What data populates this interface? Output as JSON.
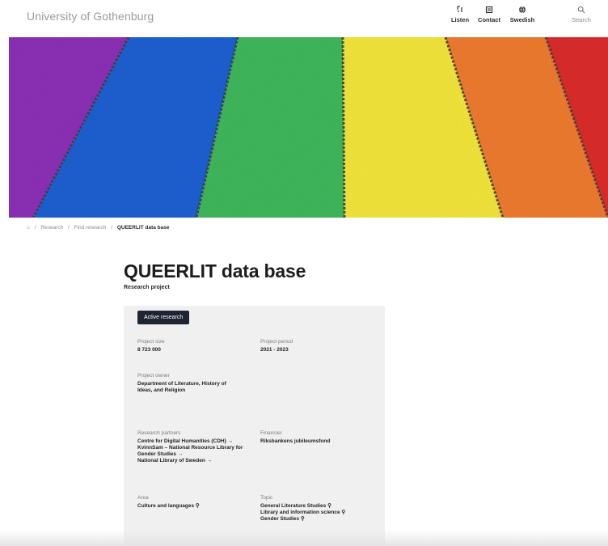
{
  "header": {
    "logo": "University of Gothenburg",
    "nav": [
      {
        "label": "Listen",
        "icon": "listen-icon"
      },
      {
        "label": "Contact",
        "icon": "contact-icon"
      },
      {
        "label": "Swedish",
        "icon": "globe-icon"
      },
      {
        "label": "Search",
        "icon": "search-icon"
      }
    ]
  },
  "hero": {
    "stripe_colors": [
      "#8b2fb5",
      "#1f5fd0",
      "#3fb65a",
      "#f1e43a",
      "#ec7a2e",
      "#d92d2a"
    ],
    "divider_color": "#3a3a3a"
  },
  "breadcrumb": {
    "home_icon": "home-icon",
    "separator": "/",
    "items": [
      "Research",
      "Find research"
    ],
    "current": "QUEERLIT data base"
  },
  "page": {
    "title": "QUEERLIT data base",
    "subtitle": "Research project"
  },
  "panel": {
    "badge": "Active research",
    "project_size": {
      "label": "Project size",
      "value": "8 723 000"
    },
    "project_period": {
      "label": "Project period",
      "value": "2021 - 2023"
    },
    "project_owner": {
      "label": "Project owner",
      "value": "Department of Literature, History of Ideas, and Religion"
    },
    "research_partners": {
      "label": "Research partners",
      "values": [
        "Centre for Digital Humanities (CDH) →",
        "KvinnSam – National Resource Library for Gender Studies →",
        "National Library of Sweden →"
      ]
    },
    "financier": {
      "label": "Financier",
      "value": "Riksbankens jubileumsfond"
    },
    "area": {
      "label": "Area",
      "values": [
        "Culture and languages ⚲"
      ]
    },
    "topic": {
      "label": "Topic",
      "values": [
        "General Literature Studies ⚲",
        "Library and information science ⚲",
        "Gender Studies ⚲"
      ]
    }
  }
}
